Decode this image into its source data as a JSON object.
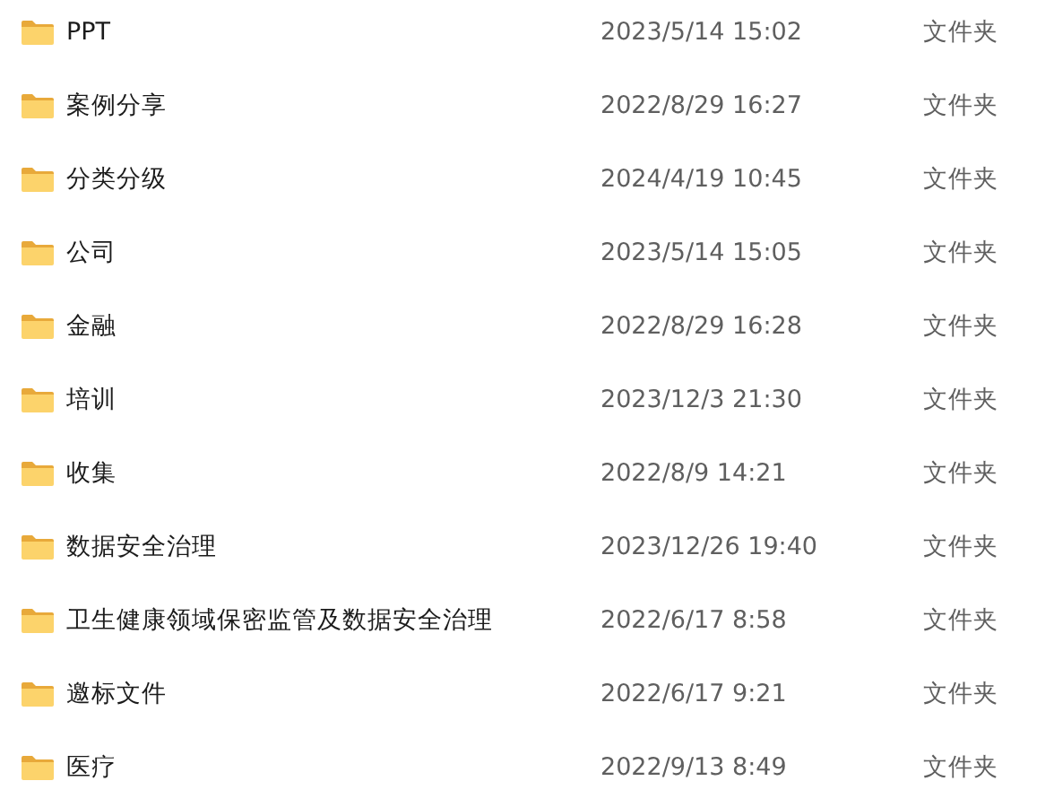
{
  "files": [
    {
      "name": "PPT",
      "modified": "2023/5/14 15:02",
      "type": "文件夹"
    },
    {
      "name": "案例分享",
      "modified": "2022/8/29 16:27",
      "type": "文件夹"
    },
    {
      "name": "分类分级",
      "modified": "2024/4/19 10:45",
      "type": "文件夹"
    },
    {
      "name": "公司",
      "modified": "2023/5/14 15:05",
      "type": "文件夹"
    },
    {
      "name": "金融",
      "modified": "2022/8/29 16:28",
      "type": "文件夹"
    },
    {
      "name": "培训",
      "modified": "2023/12/3 21:30",
      "type": "文件夹"
    },
    {
      "name": "收集",
      "modified": "2022/8/9 14:21",
      "type": "文件夹"
    },
    {
      "name": "数据安全治理",
      "modified": "2023/12/26 19:40",
      "type": "文件夹"
    },
    {
      "name": "卫生健康领域保密监管及数据安全治理",
      "modified": "2022/6/17 8:58",
      "type": "文件夹"
    },
    {
      "name": "邀标文件",
      "modified": "2022/6/17 9:21",
      "type": "文件夹"
    },
    {
      "name": "医疗",
      "modified": "2022/9/13 8:49",
      "type": "文件夹"
    }
  ]
}
